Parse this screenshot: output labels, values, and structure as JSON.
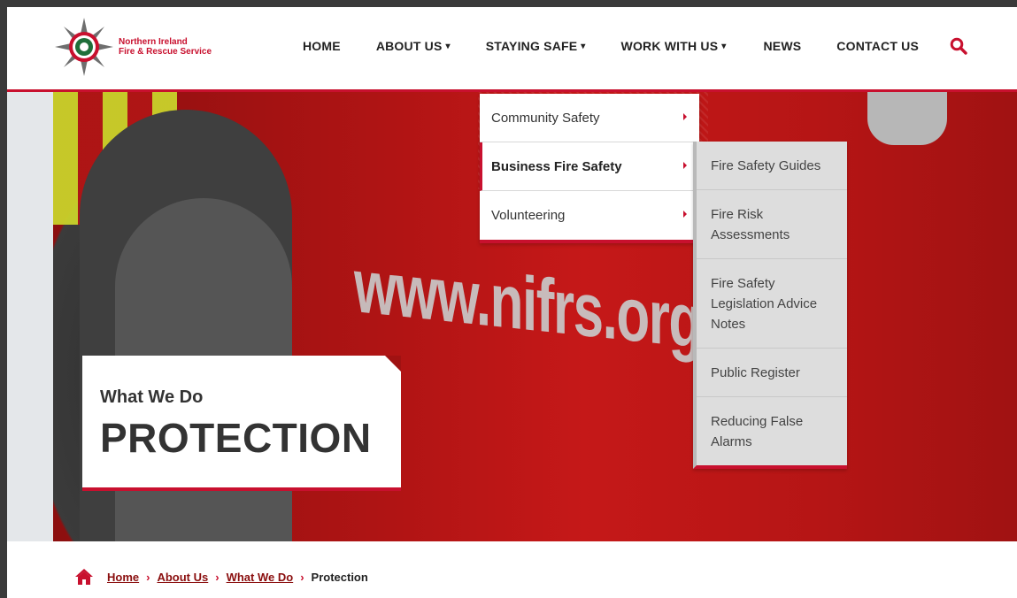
{
  "brand": {
    "name_line1": "Northern Ireland",
    "name_line2": "Fire & Rescue Service",
    "primary_color": "#c8102e"
  },
  "nav": {
    "home": "HOME",
    "about": "ABOUT US",
    "staying_safe": "STAYING SAFE",
    "work": "WORK WITH US",
    "news": "NEWS",
    "contact": "CONTACT US",
    "caret": "▾",
    "search_icon": "search-icon"
  },
  "hero": {
    "url_text": "www.nifrs.org",
    "subtitle": "What We Do",
    "title": "PROTECTION"
  },
  "dropdown": {
    "items": [
      {
        "label": "Community Safety"
      },
      {
        "label": "Business Fire Safety"
      },
      {
        "label": "Volunteering"
      }
    ]
  },
  "submenu": {
    "items": [
      {
        "label": "Fire Safety Guides"
      },
      {
        "label": "Fire Risk Assessments"
      },
      {
        "label": "Fire Safety Legislation Advice Notes"
      },
      {
        "label": "Public Register"
      },
      {
        "label": "Reducing False Alarms"
      }
    ]
  },
  "breadcrumb": {
    "home": "Home",
    "about": "About Us",
    "what": "What We Do",
    "current": "Protection",
    "sep": "›"
  }
}
